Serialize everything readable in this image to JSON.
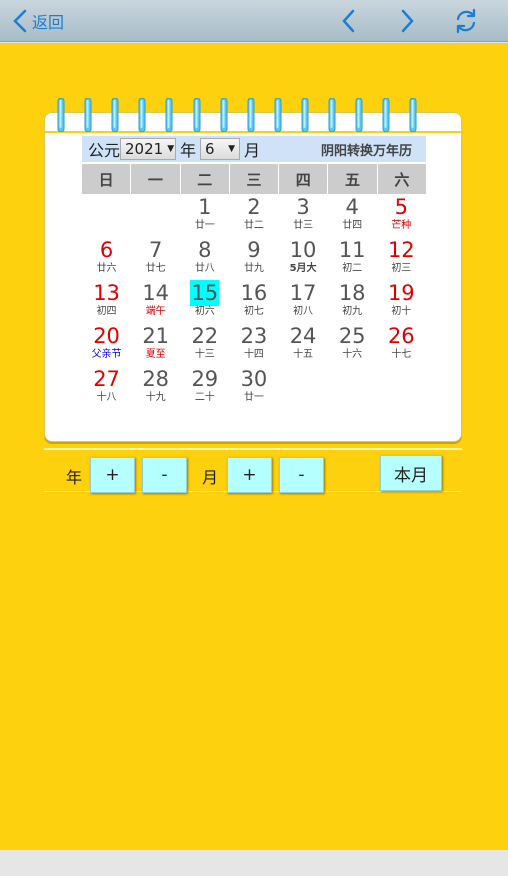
{
  "topbar": {
    "back_label": "返回"
  },
  "selector": {
    "era_label": "公元",
    "year_value": "2021",
    "year_label": "年",
    "month_value": "6",
    "month_label": "月",
    "converter_label": "阴阳转换万年历"
  },
  "weekdays": [
    "日",
    "一",
    "二",
    "三",
    "四",
    "五",
    "六"
  ],
  "weeks": [
    [
      null,
      null,
      {
        "day": "1",
        "lunar": "廿一"
      },
      {
        "day": "2",
        "lunar": "廿二"
      },
      {
        "day": "3",
        "lunar": "廿三"
      },
      {
        "day": "4",
        "lunar": "廿四"
      },
      {
        "day": "5",
        "lunar": "芒种",
        "red": true,
        "lunar_red": true
      }
    ],
    [
      {
        "day": "6",
        "lunar": "廿六",
        "red": true
      },
      {
        "day": "7",
        "lunar": "廿七"
      },
      {
        "day": "8",
        "lunar": "廿八"
      },
      {
        "day": "9",
        "lunar": "廿九"
      },
      {
        "day": "10",
        "lunar": "5月大",
        "lunar_bold": true
      },
      {
        "day": "11",
        "lunar": "初二"
      },
      {
        "day": "12",
        "lunar": "初三",
        "red": true
      }
    ],
    [
      {
        "day": "13",
        "lunar": "初四",
        "red": true
      },
      {
        "day": "14",
        "lunar": "端午",
        "lunar_red": true
      },
      {
        "day": "15",
        "lunar": "初六",
        "today": true
      },
      {
        "day": "16",
        "lunar": "初七"
      },
      {
        "day": "17",
        "lunar": "初八"
      },
      {
        "day": "18",
        "lunar": "初九"
      },
      {
        "day": "19",
        "lunar": "初十",
        "red": true
      }
    ],
    [
      {
        "day": "20",
        "lunar": "父亲节",
        "red": true,
        "lunar_blue": true
      },
      {
        "day": "21",
        "lunar": "夏至",
        "lunar_red": true
      },
      {
        "day": "22",
        "lunar": "十三"
      },
      {
        "day": "23",
        "lunar": "十四"
      },
      {
        "day": "24",
        "lunar": "十五"
      },
      {
        "day": "25",
        "lunar": "十六"
      },
      {
        "day": "26",
        "lunar": "十七",
        "red": true
      }
    ],
    [
      {
        "day": "27",
        "lunar": "十八",
        "red": true
      },
      {
        "day": "28",
        "lunar": "十九"
      },
      {
        "day": "29",
        "lunar": "二十"
      },
      {
        "day": "30",
        "lunar": "廿一"
      },
      null,
      null,
      null
    ]
  ],
  "buttons": {
    "year_label": "年",
    "year_plus": "+",
    "year_minus": "-",
    "month_label": "月",
    "month_plus": "+",
    "month_minus": "-",
    "current_month": "本月"
  },
  "colors": {
    "background": "#fdd10d",
    "accent": "#1a7fd4",
    "weekend_red": "#e00000",
    "today_highlight": "#00ffff",
    "button_bg": "#b5ffff"
  }
}
